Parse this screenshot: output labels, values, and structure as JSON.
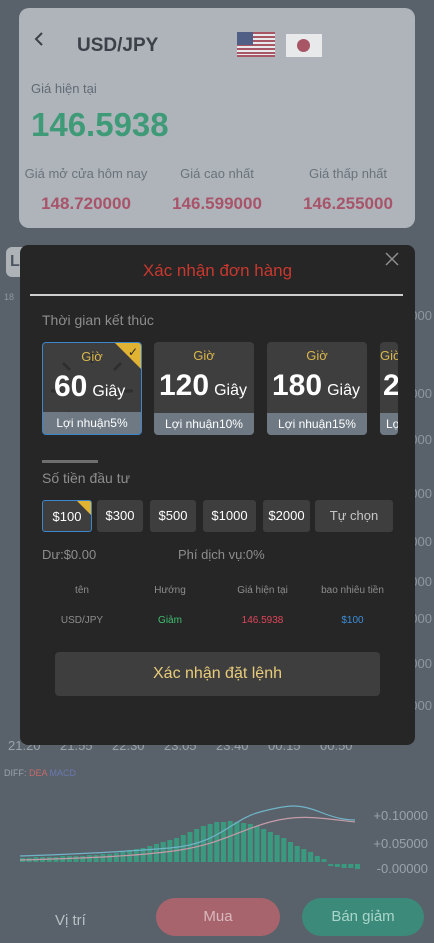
{
  "background": {
    "side_chip": "L",
    "side_label": "18",
    "right_axis": [
      "-000",
      "-000",
      "-000",
      "-000",
      "-000",
      "-000",
      "-000",
      "-000",
      "-000"
    ],
    "times": [
      "21:20",
      "21:55",
      "22:30",
      "23:05",
      "23:40",
      "00:15",
      "00:50"
    ],
    "diff_label": "DIFF:",
    "dea_label": "DEA",
    "macd_label": "MACD",
    "indicator_values": [
      "+0.10000",
      "+0.05000",
      "-0.00000"
    ],
    "colors": {
      "bar": "#3a9a80",
      "line1": "#6fb4c8",
      "line2": "#c59aa8"
    }
  },
  "header": {
    "pair": "USD/JPY",
    "current_label": "Giá hiện tại",
    "current_price": "146.5938",
    "stats": [
      {
        "label": "Giá mở cửa hôm nay",
        "value": "148.720000"
      },
      {
        "label": "Giá cao nhất",
        "value": "146.599000"
      },
      {
        "label": "Giá thấp nhất",
        "value": "146.255000"
      }
    ]
  },
  "modal": {
    "title": "Xác nhận đơn hàng",
    "end_time_label": "Thời gian kết thúc",
    "time_options": [
      {
        "gio": "Giờ",
        "num": "60",
        "unit": "Giây",
        "profit": "Lợi nhuận5%",
        "selected": true
      },
      {
        "gio": "Giờ",
        "num": "120",
        "unit": "Giây",
        "profit": "Lợi nhuận10%",
        "selected": false
      },
      {
        "gio": "Giờ",
        "num": "180",
        "unit": "Giây",
        "profit": "Lợi nhuận15%",
        "selected": false
      },
      {
        "gio": "Giờ",
        "num": "2",
        "unit": "",
        "profit": "Lợ",
        "selected": false
      }
    ],
    "amount_label": "Số tiền đầu tư",
    "amounts": [
      "$100",
      "$300",
      "$500",
      "$1000",
      "$2000",
      "Tự chọn"
    ],
    "balance": "Dư:$0.00",
    "fee": "Phí dịch vụ:0%",
    "summary": {
      "headers": [
        "tên",
        "Hướng",
        "Giá hiện tại",
        "bao nhiêu tiền"
      ],
      "values": [
        "USD/JPY",
        "Giảm",
        "146.5938",
        "$100"
      ]
    },
    "confirm_label": "Xác nhận đặt lệnh"
  },
  "bottom": {
    "position_label": "Vị trí",
    "buy_label": "Mua",
    "sell_label": "Bán giảm"
  }
}
